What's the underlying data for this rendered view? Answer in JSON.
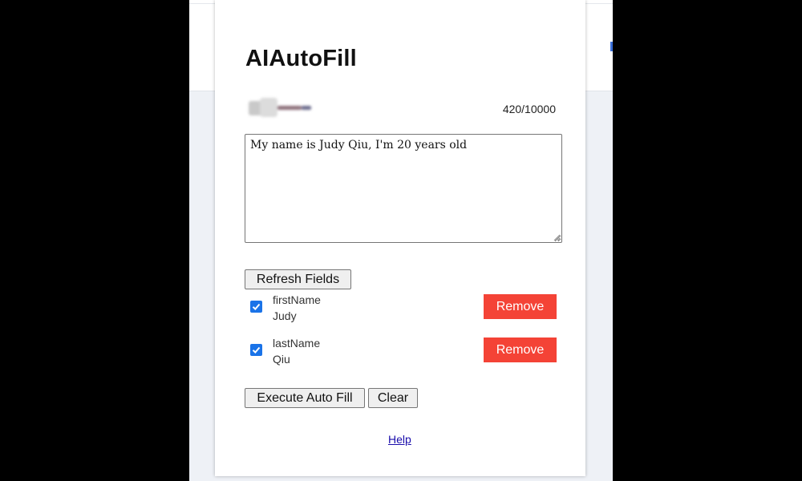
{
  "app": {
    "title": "AIAutoFill"
  },
  "usage": {
    "counter": "420/10000"
  },
  "prompt": {
    "value": "My name is Judy Qiu, I'm 20 years old"
  },
  "actions": {
    "refresh_label": "Refresh Fields",
    "execute_label": "Execute Auto Fill",
    "clear_label": "Clear"
  },
  "fields": [
    {
      "name": "firstName",
      "value": "Judy",
      "checked": true,
      "remove_label": "Remove"
    },
    {
      "name": "lastName",
      "value": "Qiu",
      "checked": true,
      "remove_label": "Remove"
    }
  ],
  "footer": {
    "help_label": "Help"
  },
  "colors": {
    "remove": "#f44336",
    "checkbox": "#1a73e8",
    "link": "#1a0dab"
  }
}
